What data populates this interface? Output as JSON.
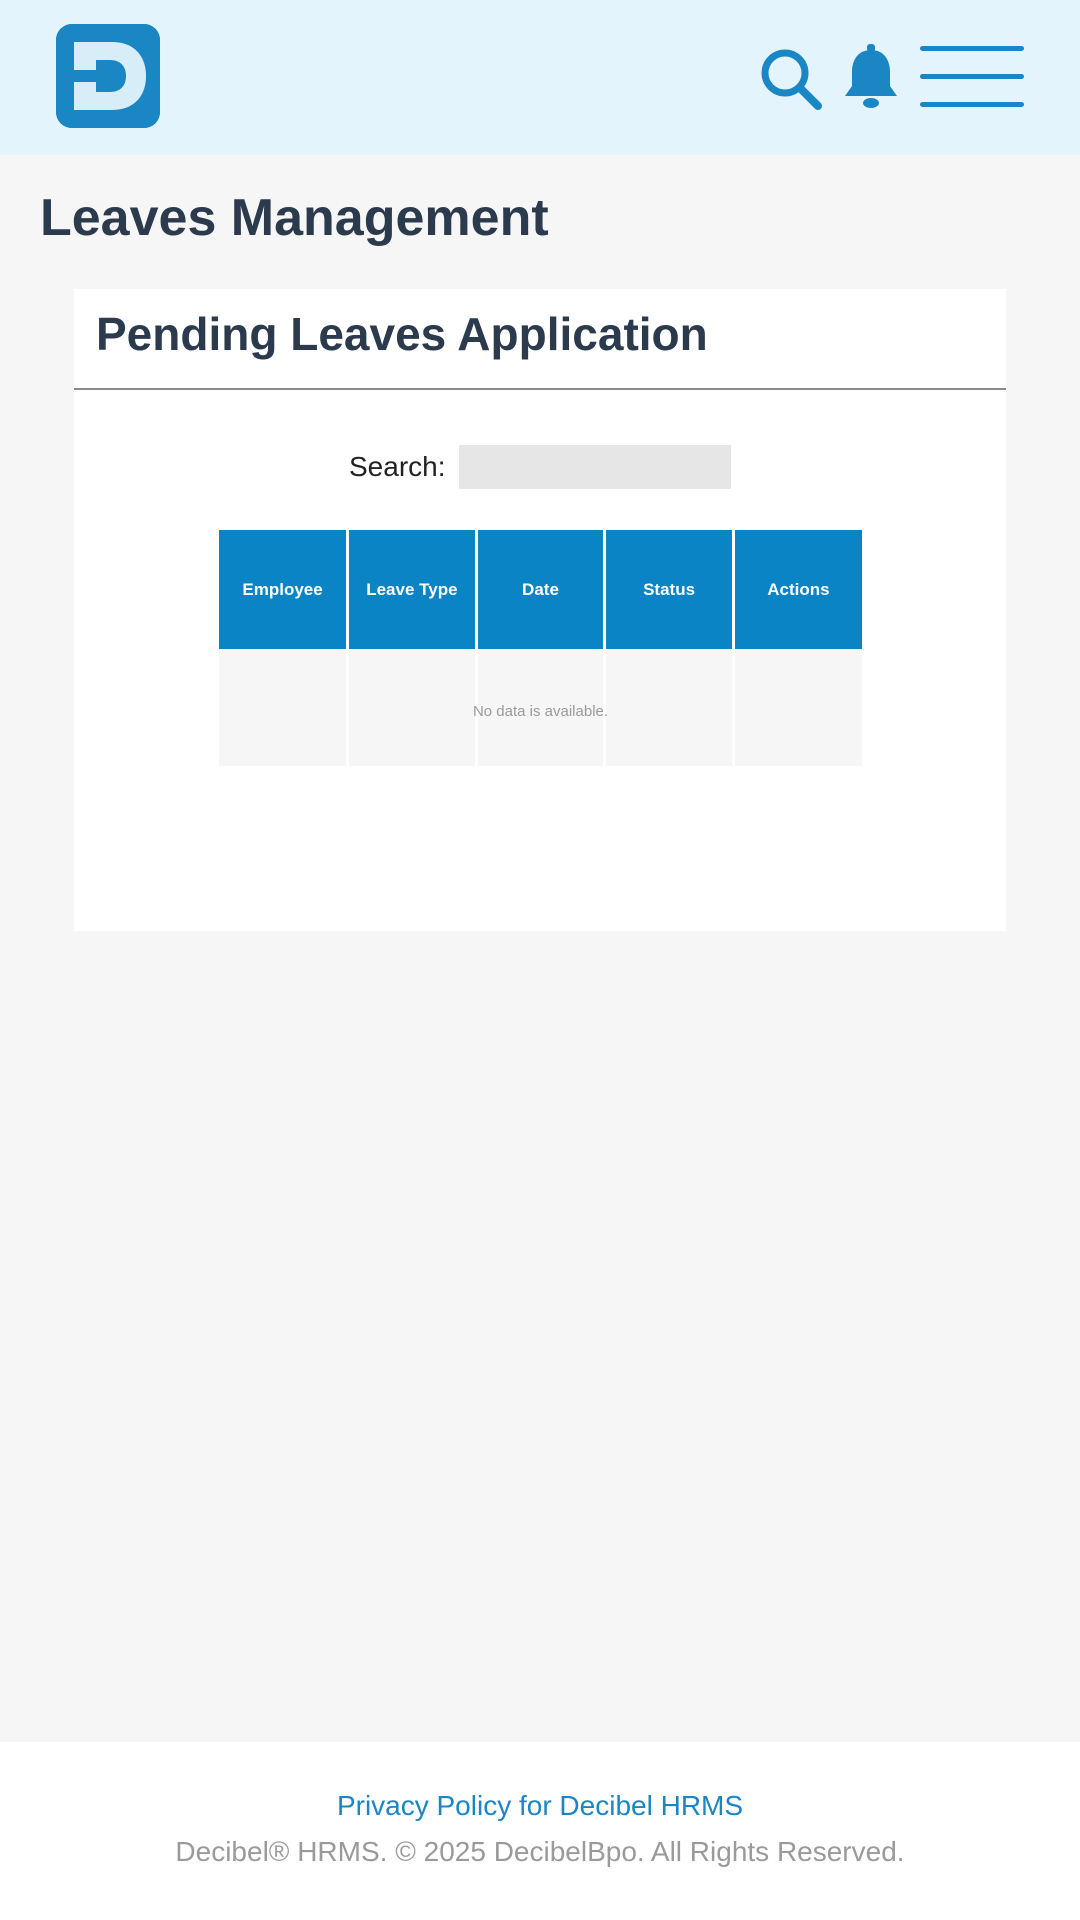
{
  "header": {
    "logo_icon": "decibel-d-logo",
    "search_icon": "search-icon",
    "bell_icon": "bell-icon",
    "menu_icon": "hamburger-menu-icon",
    "accent_color": "#1a86c4",
    "background_color": "#e4f4fc"
  },
  "page": {
    "title": "Leaves Management"
  },
  "card": {
    "title": "Pending Leaves Application",
    "search_label": "Search:",
    "search_value": "",
    "table": {
      "columns": [
        "Employee",
        "Leave Type",
        "Date",
        "Status",
        "Actions"
      ],
      "rows": [],
      "empty_message": "No data is available.",
      "header_color": "#0b84c6"
    }
  },
  "footer": {
    "privacy_link": "Privacy Policy for Decibel HRMS",
    "copyright": "Decibel® HRMS. © 2025 DecibelBpo. All Rights Reserved."
  }
}
